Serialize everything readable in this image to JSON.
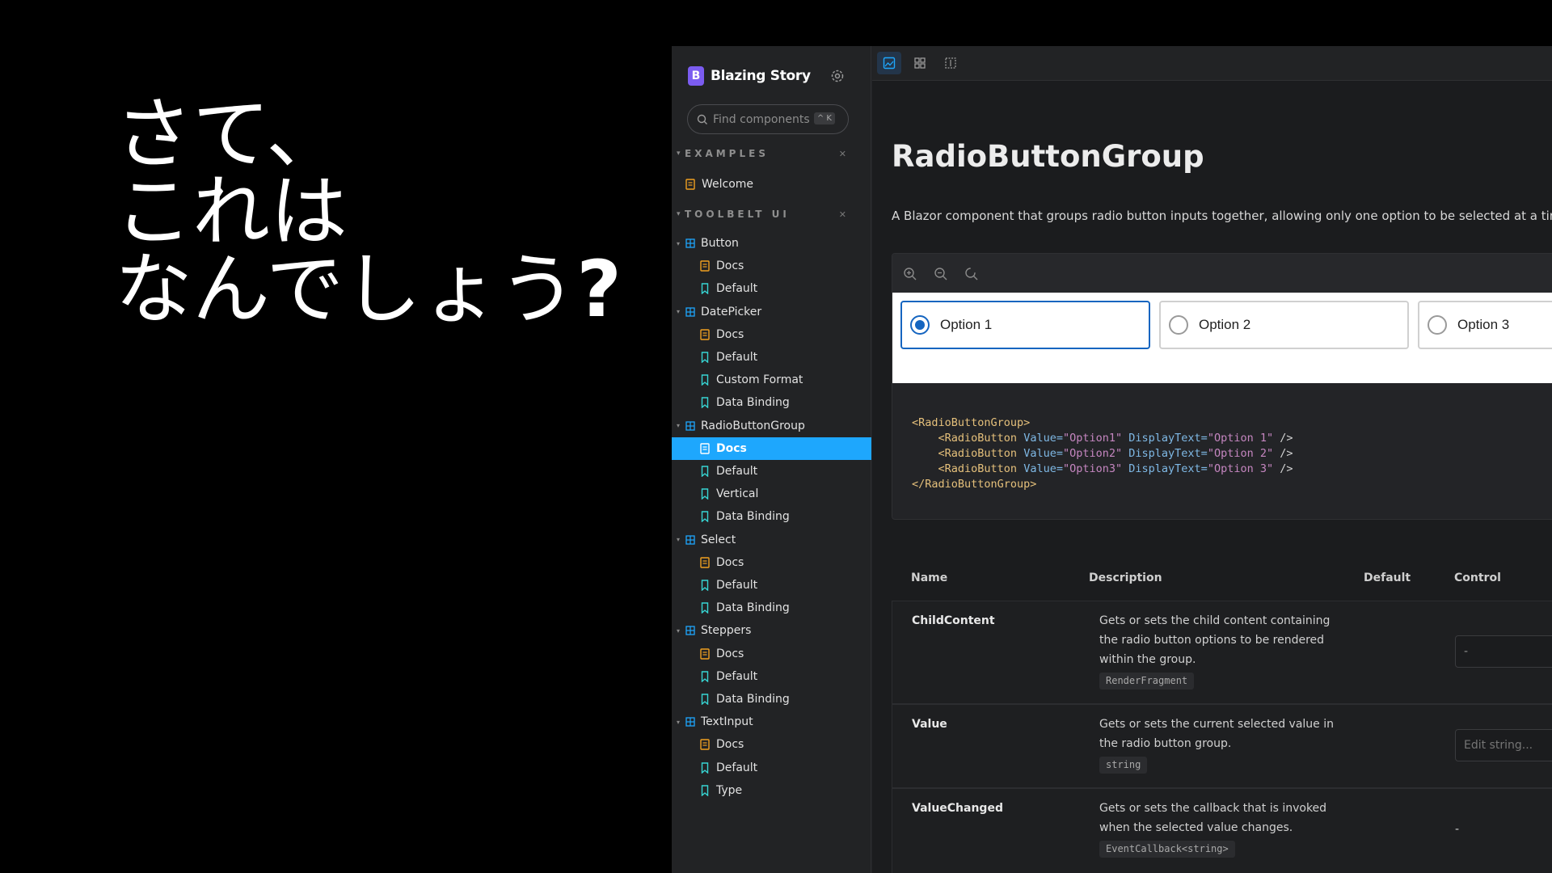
{
  "slide": {
    "line1": "さて、",
    "line2": "これは",
    "line3a": "なんでしょう",
    "line3b": "?"
  },
  "brand": {
    "name": "Blazing Story",
    "logo_letter": "B"
  },
  "search": {
    "placeholder": "Find components",
    "shortcut": "^ K"
  },
  "sections": [
    {
      "label": "EXAMPLES"
    },
    {
      "label": "TOOLBELT UI"
    }
  ],
  "tree": {
    "welcome": "Welcome",
    "button": "Button",
    "button_docs": "Docs",
    "button_default": "Default",
    "datepicker": "DatePicker",
    "dp_docs": "Docs",
    "dp_default": "Default",
    "dp_custom": "Custom Format",
    "dp_binding": "Data Binding",
    "rbg": "RadioButtonGroup",
    "rbg_docs": "Docs",
    "rbg_default": "Default",
    "rbg_vertical": "Vertical",
    "rbg_binding": "Data Binding",
    "select": "Select",
    "sel_docs": "Docs",
    "sel_default": "Default",
    "sel_binding": "Data Binding",
    "steppers": "Steppers",
    "st_docs": "Docs",
    "st_default": "Default",
    "st_binding": "Data Binding",
    "textinput": "TextInput",
    "ti_docs": "Docs",
    "ti_default": "Default",
    "ti_type": "Type"
  },
  "doc": {
    "title": "RadioButtonGroup",
    "description": "A Blazor component that groups radio button inputs together, allowing only one option to be selected at a time"
  },
  "preview": {
    "options": [
      "Option 1",
      "Option 2",
      "Option 3"
    ],
    "selected": "Option 1"
  },
  "code": {
    "open": "<RadioButtonGroup>",
    "lines": [
      {
        "value": "\"Option1\"",
        "text": "\"Option 1\""
      },
      {
        "value": "\"Option2\"",
        "text": "\"Option 2\""
      },
      {
        "value": "\"Option3\"",
        "text": "\"Option 3\""
      }
    ],
    "close": "</RadioButtonGroup>",
    "item_tag": "<RadioButton",
    "value_attr": "Value=",
    "text_attr": "DisplayText=",
    "end": "/>"
  },
  "props": {
    "headers": {
      "name": "Name",
      "description": "Description",
      "default": "Default",
      "control": "Control"
    },
    "rows": [
      {
        "name": "ChildContent",
        "description": "Gets or sets the child content containing the radio button options to be rendered within the group.",
        "type": "RenderFragment",
        "control": "-"
      },
      {
        "name": "Value",
        "description": "Gets or sets the current selected value in the radio button group.",
        "type": "string",
        "control_placeholder": "Edit string..."
      },
      {
        "name": "ValueChanged",
        "description": "Gets or sets the callback that is invoked when the selected value changes.",
        "type": "EventCallback<string>",
        "control": "-"
      }
    ]
  },
  "colors": {
    "accent": "#1ea7fd",
    "radio_checked": "#1565c0",
    "brand": "#7b5cf0"
  }
}
